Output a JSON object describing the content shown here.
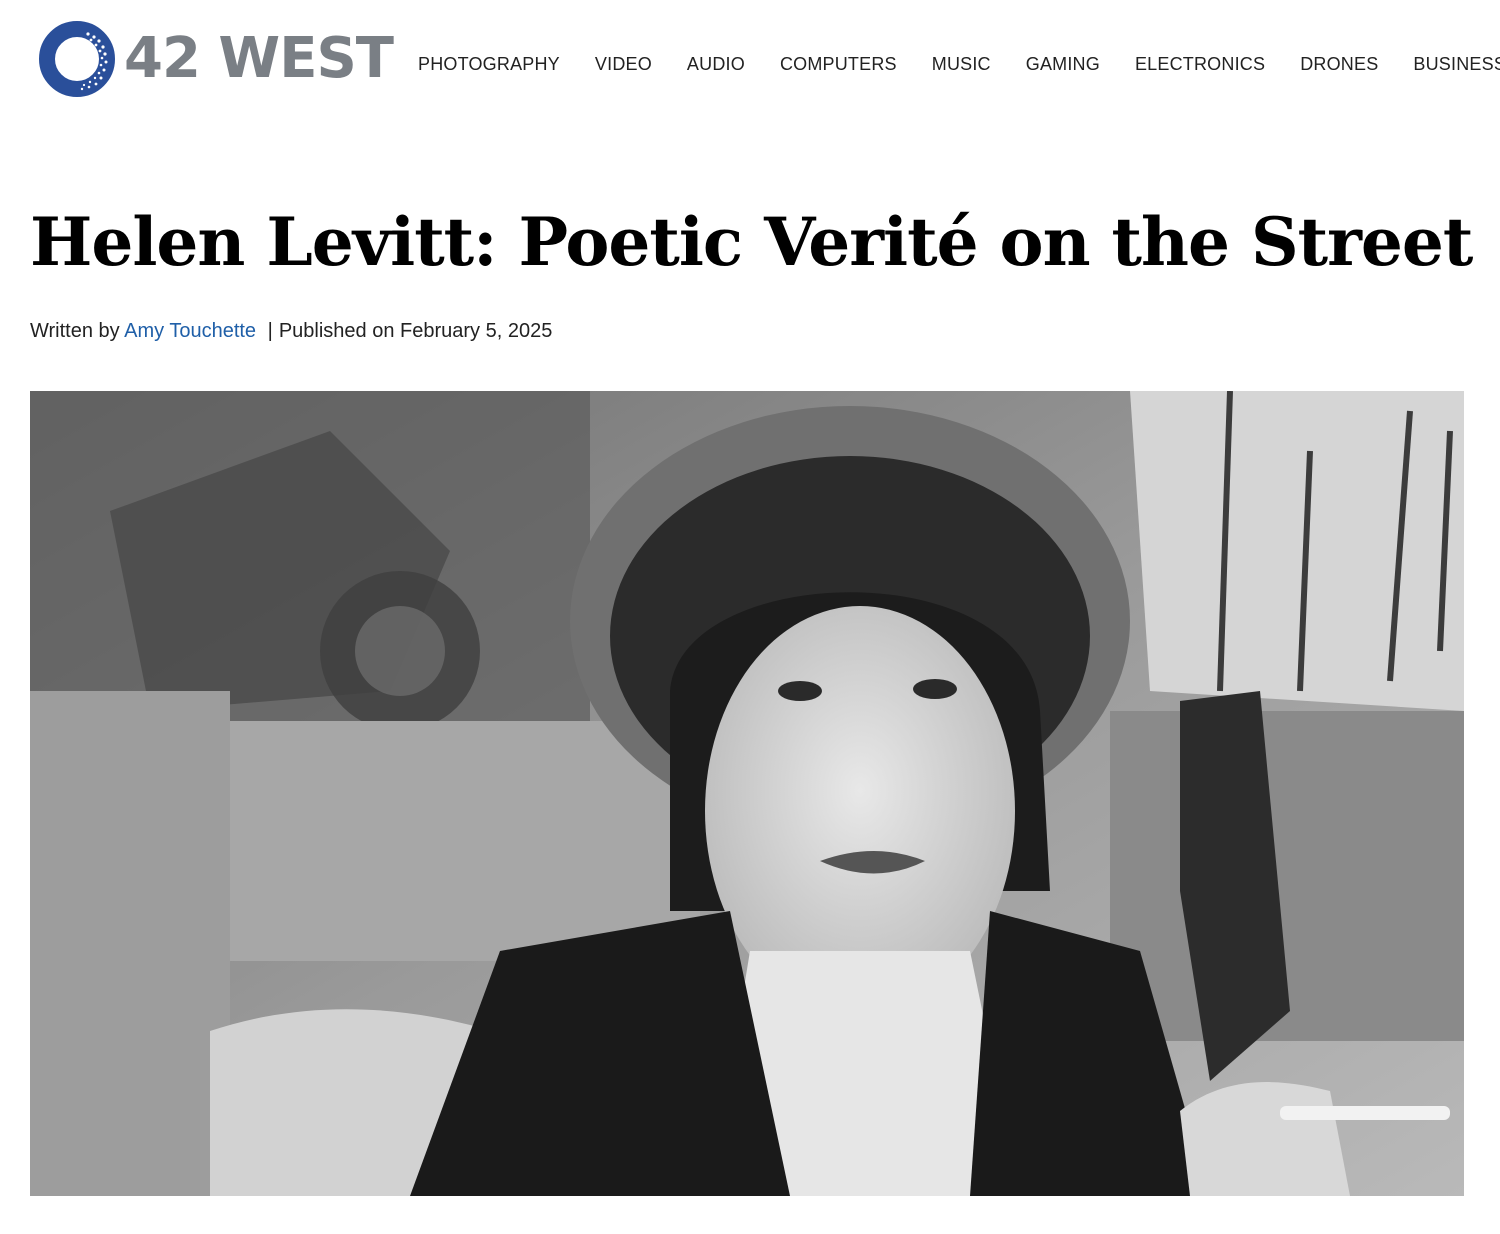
{
  "brand": {
    "logo_text": "42 WEST",
    "logo_icon": "dotted-ring-logo-icon",
    "logo_color": "#2a4f9a",
    "text_color": "#7a7f85"
  },
  "nav": {
    "items": [
      {
        "label": "PHOTOGRAPHY"
      },
      {
        "label": "VIDEO"
      },
      {
        "label": "AUDIO"
      },
      {
        "label": "COMPUTERS"
      },
      {
        "label": "MUSIC"
      },
      {
        "label": "GAMING"
      },
      {
        "label": "ELECTRONICS"
      },
      {
        "label": "DRONES"
      },
      {
        "label": "BUSINESS"
      }
    ]
  },
  "article": {
    "title": "Helen Levitt: Poetic Verité on the Street",
    "byline": {
      "written_by_prefix": "Written by",
      "author": "Amy Touchette",
      "separator": "|",
      "published_text": "Published on February 5, 2025"
    },
    "author_link_color": "#1f5fa8"
  },
  "hero_image": {
    "style": "black-and-white photograph"
  }
}
